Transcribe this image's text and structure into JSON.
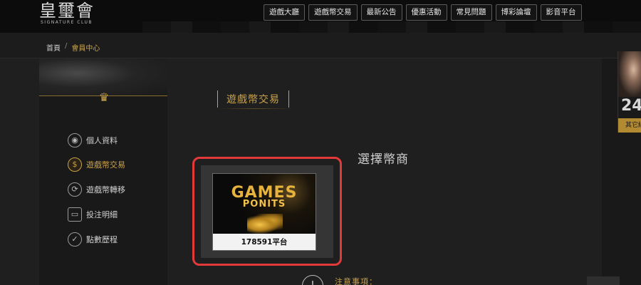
{
  "header": {
    "logo_main": "皇璽會",
    "logo_sub": "SIGNATURE CLUB",
    "nav": [
      "遊戲大廳",
      "遊戲幣交易",
      "最新公告",
      "優惠活動",
      "常見問題",
      "博彩論壇",
      "影音平台"
    ]
  },
  "breadcrumb": {
    "home": "首頁",
    "separator": "/",
    "current": "會員中心"
  },
  "sidebar": {
    "items": [
      {
        "label": "個人資料",
        "icon": "user-icon",
        "active": false
      },
      {
        "label": "遊戲幣交易",
        "icon": "money-bag-icon",
        "active": true
      },
      {
        "label": "遊戲幣轉移",
        "icon": "transfer-icon",
        "active": false
      },
      {
        "label": "投注明細",
        "icon": "wallet-icon",
        "active": false
      },
      {
        "label": "點數歷程",
        "icon": "check-circle-icon",
        "active": false
      }
    ]
  },
  "main": {
    "section_title": "遊戲幣交易",
    "merchant_heading": "選擇幣商",
    "merchant_card": {
      "games_text": "GAMES",
      "ponits_text": "PONITS",
      "label": "178591平台"
    },
    "notice_title": "注意事項："
  },
  "promo": {
    "number": "24",
    "bar_text": "其它線"
  },
  "colors": {
    "gold": "#c9a24a",
    "highlight": "#e23a3a",
    "background": "#1f1f1f"
  }
}
